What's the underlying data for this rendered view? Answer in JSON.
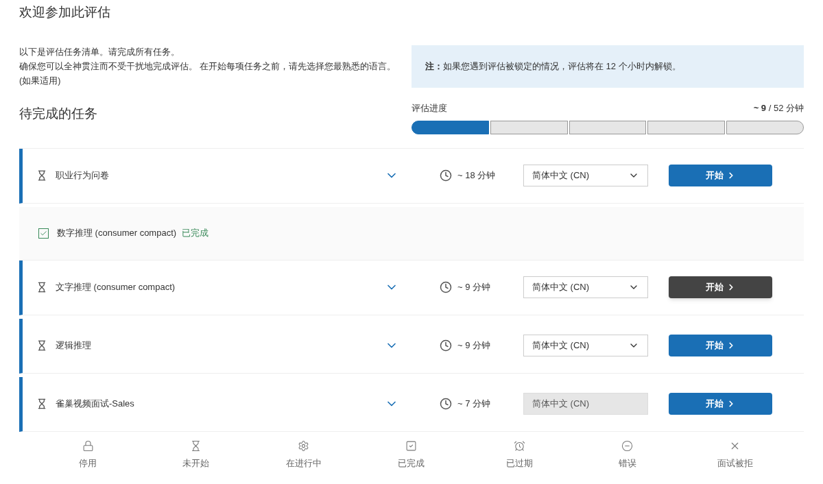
{
  "title": "欢迎参加此评估",
  "intro": [
    "以下是评估任务清单。请完成所有任务。",
    "确保您可以全神贯注而不受干扰地完成评估。 在开始每项任务之前，请先选择您最熟悉的语言。 (如果适用)"
  ],
  "note": {
    "label": "注：",
    "text": "如果您遇到评估被锁定的情况，评估将在 12 个小时内解锁。"
  },
  "section_title": "待完成的任务",
  "progress": {
    "label": "评估进度",
    "reading": "**~ 9** / 52 分钟",
    "segments": [
      {
        "filled": true
      },
      {
        "filled": false
      },
      {
        "filled": false
      },
      {
        "filled": false
      },
      {
        "filled": false
      }
    ]
  },
  "tasks": [
    {
      "kind": "pending",
      "name": "职业行为问卷",
      "duration": "~ 18 分钟",
      "language": "简体中文 (CN)",
      "language_disabled": false,
      "button": "开始",
      "hovered": false
    },
    {
      "kind": "completed",
      "name": "数字推理 (consumer compact)",
      "status": "已完成"
    },
    {
      "kind": "pending",
      "name": "文字推理 (consumer compact)",
      "duration": "~ 9 分钟",
      "language": "简体中文 (CN)",
      "language_disabled": false,
      "button": "开始",
      "hovered": true
    },
    {
      "kind": "pending",
      "name": "逻辑推理",
      "duration": "~ 9 分钟",
      "language": "简体中文 (CN)",
      "language_disabled": false,
      "button": "开始",
      "hovered": false
    },
    {
      "kind": "pending",
      "name": "雀巢视频面试-Sales",
      "duration": "~ 7 分钟",
      "language": "简体中文 (CN)",
      "language_disabled": true,
      "button": "开始",
      "hovered": false
    }
  ],
  "legend": [
    {
      "kind": "lock",
      "label": "停用"
    },
    {
      "kind": "hourglass",
      "label": "未开始"
    },
    {
      "kind": "gear",
      "label": "在进行中"
    },
    {
      "kind": "check",
      "label": "已完成"
    },
    {
      "kind": "alarm",
      "label": "已过期"
    },
    {
      "kind": "minus",
      "label": "错误"
    },
    {
      "kind": "x",
      "label": "面试被拒"
    }
  ]
}
